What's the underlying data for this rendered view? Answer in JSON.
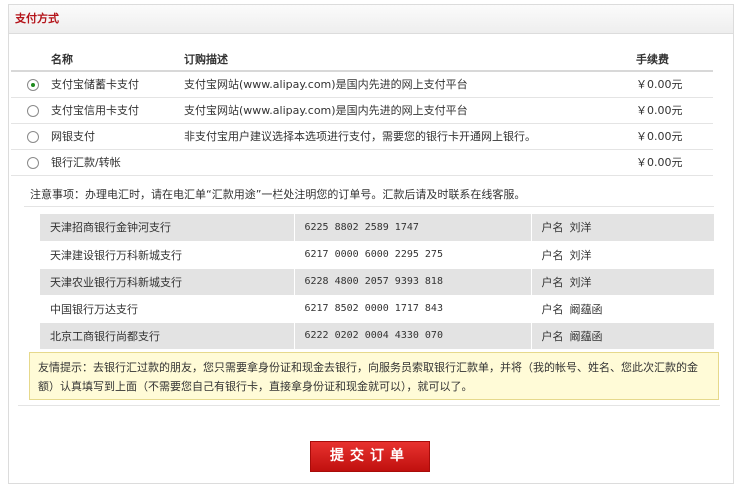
{
  "panel": {
    "title": "支付方式"
  },
  "table": {
    "headers": {
      "name": "名称",
      "desc": "订购描述",
      "fee": "手续费"
    },
    "rows": [
      {
        "name": "支付宝储蓄卡支付",
        "desc": "支付宝网站(www.alipay.com)是国内先进的网上支付平台",
        "fee": "￥0.00元",
        "selected": true
      },
      {
        "name": "支付宝信用卡支付",
        "desc": "支付宝网站(www.alipay.com)是国内先进的网上支付平台",
        "fee": "￥0.00元",
        "selected": false
      },
      {
        "name": "网银支付",
        "desc": "非支付宝用户建议选择本选项进行支付，需要您的银行卡开通网上银行。",
        "fee": "￥0.00元",
        "selected": false
      },
      {
        "name": "银行汇款/转帐",
        "desc": "",
        "fee": "￥0.00元",
        "selected": false
      }
    ]
  },
  "notice": "注意事项：办理电汇时，请在电汇单“汇款用途”一栏处注明您的订单号。汇款后请及时联系在线客服。",
  "banks": {
    "holder_label": "户名",
    "rows": [
      {
        "name": "天津招商银行金钟河支行",
        "account": "6225 8802 2589 1747",
        "holder": "刘洋"
      },
      {
        "name": "天津建设银行万科新城支行",
        "account": "6217 0000 6000 2295 275",
        "holder": "刘洋"
      },
      {
        "name": "天津农业银行万科新城支行",
        "account": "6228 4800 2057 9393 818",
        "holder": "刘洋"
      },
      {
        "name": "中国银行万达支行",
        "account": "6217 8502 0000 1717 843",
        "holder": "阚蕴函"
      },
      {
        "name": "北京工商银行尚都支行",
        "account": "6222 0202 0004 4330 070",
        "holder": "阚蕴函"
      }
    ]
  },
  "tip": "友情提示：去银行汇过款的朋友，您只需要拿身份证和现金去银行，向服务员索取银行汇款单，并将（我的帐号、姓名、您此次汇款的金额）认真填写到上面（不需要您自己有银行卡，直接拿身份证和现金就可以），就可以了。",
  "submit_label": "提交订单"
}
